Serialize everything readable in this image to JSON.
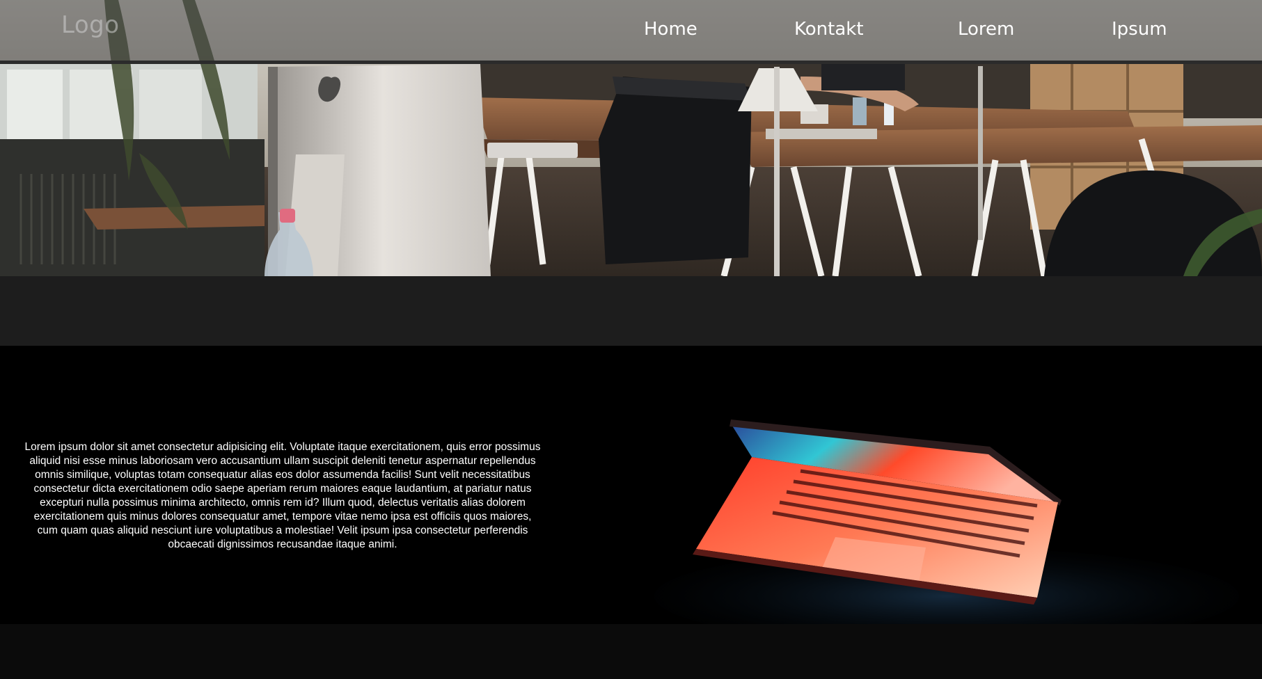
{
  "header": {
    "logo": "Logo",
    "nav": [
      "Home",
      "Kontakt",
      "Lorem",
      "Ipsum"
    ]
  },
  "hero": {
    "image_alt": "office workspace photo"
  },
  "content": {
    "paragraph": "Lorem ipsum dolor sit amet consectetur adipisicing elit. Voluptate itaque exercitationem, quis error possimus aliquid nisi esse minus laboriosam vero accusantium ullam suscipit deleniti tenetur aspernatur repellendus omnis similique, voluptas totam consequatur alias eos dolor assumenda facilis! Sunt velit necessitatibus consectetur dicta exercitationem odio saepe aperiam rerum maiores eaque laudantium, at pariatur natus excepturi nulla possimus minima architecto, omnis rem id? Illum quod, delectus veritatis alias dolorem exercitationem quis minus dolores consequatur amet, tempore vitae nemo ipsa est officiis quos maiores, cum quam quas aliquid nesciunt iure voluptatibus a molestiae! Velit ipsum ipsa consectetur perferendis obcaecati dignissimos recusandae itaque animi.",
    "image_alt": "glowing laptop photo"
  },
  "colors": {
    "nav_bg": "#464646",
    "band": "#1d1d1d",
    "section": "#000000",
    "text": "#ffffff"
  }
}
